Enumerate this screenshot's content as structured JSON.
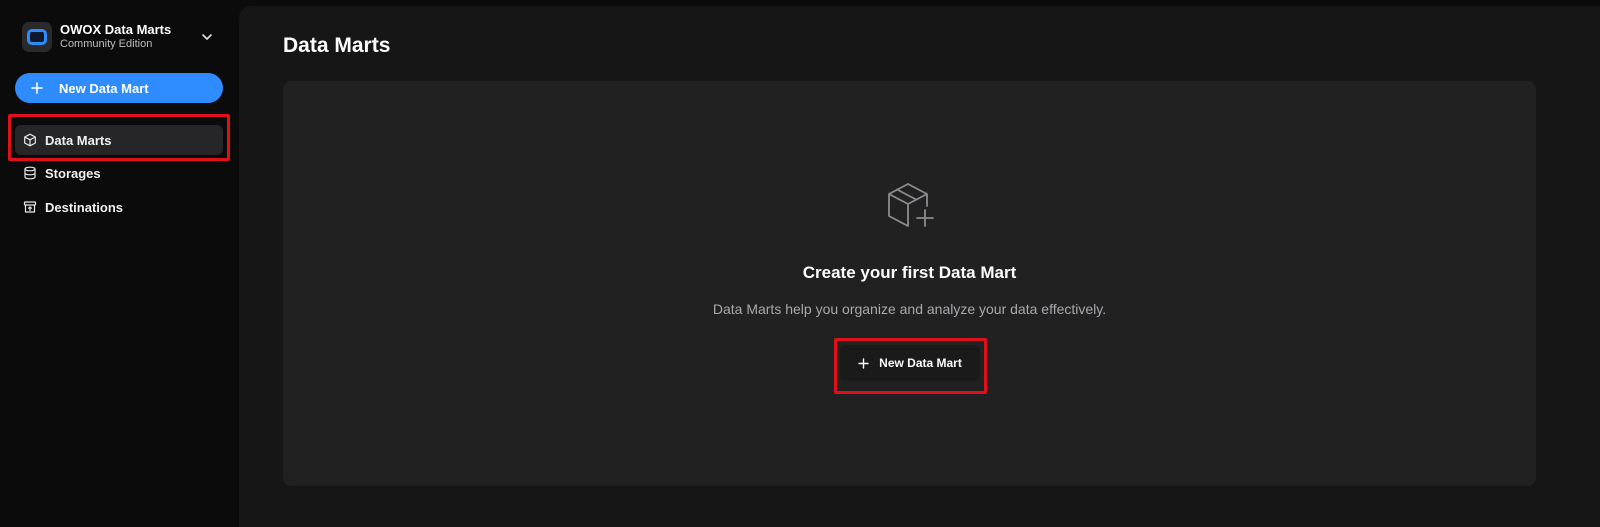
{
  "brand": {
    "title": "OWOX Data Marts",
    "subtitle": "Community Edition"
  },
  "sidebar": {
    "new_button_label": "New Data Mart",
    "items": [
      {
        "label": "Data Marts",
        "icon": "cube-icon",
        "active": true
      },
      {
        "label": "Storages",
        "icon": "database-icon",
        "active": false
      },
      {
        "label": "Destinations",
        "icon": "archive-icon",
        "active": false
      }
    ]
  },
  "main": {
    "title": "Data Marts",
    "empty_state": {
      "icon": "cube-plus-icon",
      "title": "Create your first Data Mart",
      "description": "Data Marts help you organize and analyze your data effectively.",
      "button_label": "New Data Mart"
    }
  },
  "colors": {
    "accent": "#2f8cff",
    "highlight": "#e0101a",
    "panel": "#161617",
    "card": "#212122"
  }
}
